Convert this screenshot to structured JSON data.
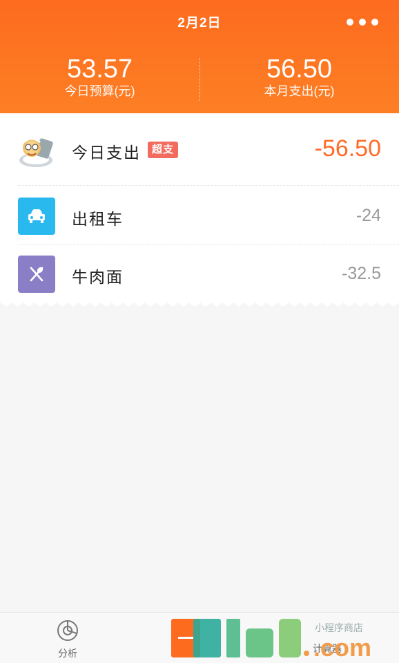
{
  "header": {
    "date": "2月2日",
    "budget_today": {
      "value": "53.57",
      "label": "今日预算(元)"
    },
    "month_spend": {
      "value": "56.50",
      "label": "本月支出(元)"
    }
  },
  "summary": {
    "label": "今日支出",
    "badge": "超支",
    "amount": "-56.50"
  },
  "items": [
    {
      "icon": "car-icon",
      "name": "出租车",
      "amount": "-24",
      "color": "#29b9ee"
    },
    {
      "icon": "utensils-icon",
      "name": "牛肉面",
      "amount": "-32.5",
      "color": "#8a7fc6"
    }
  ],
  "tabbar": {
    "analysis_label": "分析",
    "calc_label": "计算器"
  },
  "watermark": {
    "text": "9lud.com",
    "subtext": "小程序商店"
  },
  "colors": {
    "header": "#fd6b1f",
    "accent": "#ff6b28",
    "badge": "#f26b5e"
  }
}
